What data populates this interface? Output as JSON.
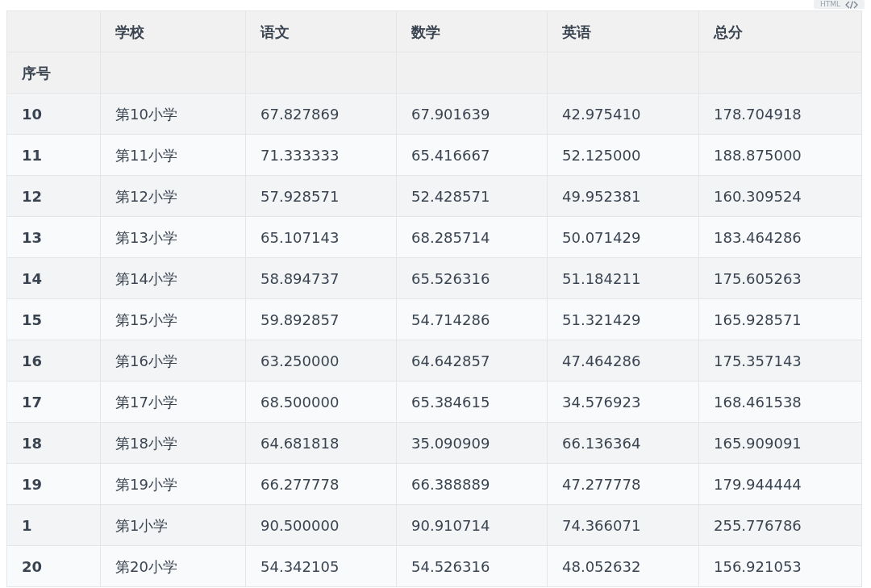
{
  "badge": {
    "label": "HTML"
  },
  "table": {
    "columns": [
      "",
      "学校",
      "语文",
      "数学",
      "英语",
      "总分"
    ],
    "index_name": "序号",
    "rows": [
      [
        "10",
        "第10小学",
        "67.827869",
        "67.901639",
        "42.975410",
        "178.704918"
      ],
      [
        "11",
        "第11小学",
        "71.333333",
        "65.416667",
        "52.125000",
        "188.875000"
      ],
      [
        "12",
        "第12小学",
        "57.928571",
        "52.428571",
        "49.952381",
        "160.309524"
      ],
      [
        "13",
        "第13小学",
        "65.107143",
        "68.285714",
        "50.071429",
        "183.464286"
      ],
      [
        "14",
        "第14小学",
        "58.894737",
        "65.526316",
        "51.184211",
        "175.605263"
      ],
      [
        "15",
        "第15小学",
        "59.892857",
        "54.714286",
        "51.321429",
        "165.928571"
      ],
      [
        "16",
        "第16小学",
        "63.250000",
        "64.642857",
        "47.464286",
        "175.357143"
      ],
      [
        "17",
        "第17小学",
        "68.500000",
        "65.384615",
        "34.576923",
        "168.461538"
      ],
      [
        "18",
        "第18小学",
        "64.681818",
        "35.090909",
        "66.136364",
        "165.909091"
      ],
      [
        "19",
        "第19小学",
        "66.277778",
        "66.388889",
        "47.277778",
        "179.944444"
      ],
      [
        "1",
        "第1小学",
        "90.500000",
        "90.910714",
        "74.366071",
        "255.776786"
      ],
      [
        "20",
        "第20小学",
        "54.342105",
        "54.526316",
        "48.052632",
        "156.921053"
      ]
    ]
  }
}
